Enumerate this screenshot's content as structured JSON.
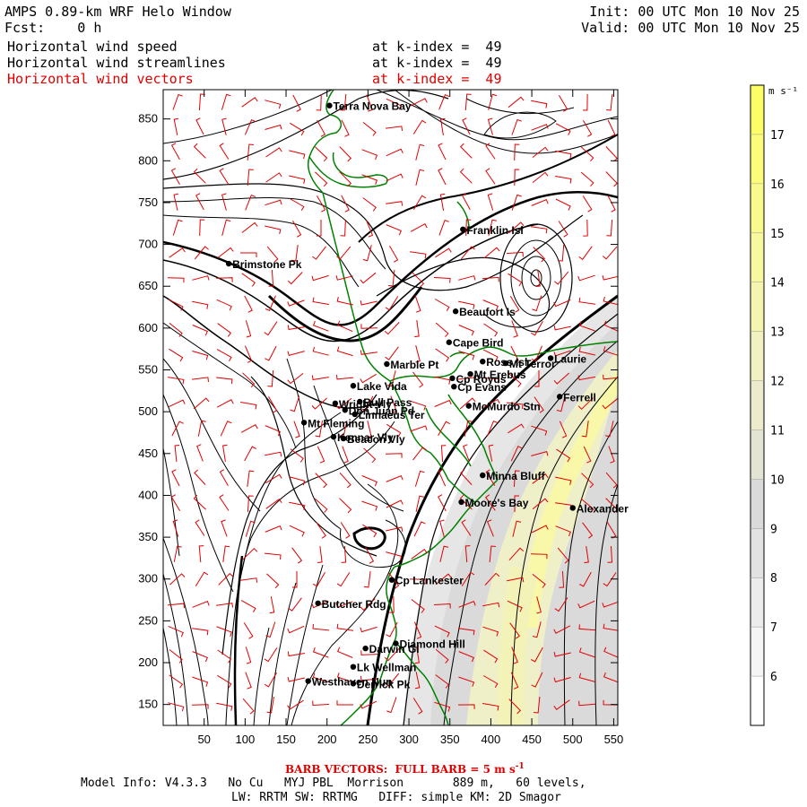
{
  "header": {
    "title": "AMPS 0.89-km WRF Helo Window",
    "fcst": "Fcst:    0 h",
    "init": "Init: 00 UTC Mon 10 Nov 25",
    "valid": "Valid: 00 UTC Mon 10 Nov 25",
    "fields": [
      {
        "name": "Horizontal wind speed",
        "level": "at k-index =  49",
        "color": "#000000"
      },
      {
        "name": "Horizontal wind streamlines",
        "level": "at k-index =  49",
        "color": "#000000"
      },
      {
        "name": "Horizontal wind vectors",
        "level": "at k-index =  49",
        "color": "#e00000"
      }
    ]
  },
  "map": {
    "x_ticks": [
      50,
      100,
      150,
      200,
      250,
      300,
      350,
      400,
      450,
      500,
      550
    ],
    "y_ticks": [
      150,
      200,
      250,
      300,
      350,
      400,
      450,
      500,
      550,
      600,
      650,
      700,
      750,
      800,
      850
    ],
    "xlim": [
      0,
      555
    ],
    "ylim": [
      125,
      885
    ],
    "coast_color": "#008000",
    "barb_color": "#e00000",
    "stations": [
      {
        "name": "Terra Nova Bay",
        "x": 203,
        "y": 866
      },
      {
        "name": "Franklin Isl",
        "x": 366,
        "y": 718
      },
      {
        "name": "Brimstone Pk",
        "x": 80,
        "y": 677
      },
      {
        "name": "Beaufort Is",
        "x": 357,
        "y": 620
      },
      {
        "name": "Cape Bird",
        "x": 349,
        "y": 583
      },
      {
        "name": "Marble Pt",
        "x": 273,
        "y": 557
      },
      {
        "name": "Lake Vida",
        "x": 232,
        "y": 531
      },
      {
        "name": "Cp Royds",
        "x": 353,
        "y": 540
      },
      {
        "name": "Cp Evans",
        "x": 355,
        "y": 530
      },
      {
        "name": "Mt Erebus",
        "x": 375,
        "y": 545
      },
      {
        "name": "Ross Isl",
        "x": 390,
        "y": 560
      },
      {
        "name": "Mt Terror",
        "x": 418,
        "y": 558
      },
      {
        "name": "Laurie",
        "x": 473,
        "y": 564
      },
      {
        "name": "Ferrell",
        "x": 484,
        "y": 518
      },
      {
        "name": "Wright Vly",
        "x": 210,
        "y": 510
      },
      {
        "name": "Don Juan Pd",
        "x": 222,
        "y": 502
      },
      {
        "name": "Bull Pass",
        "x": 240,
        "y": 512
      },
      {
        "name": "Linnaeus Ter",
        "x": 234,
        "y": 497
      },
      {
        "name": "Mt Fleming",
        "x": 172,
        "y": 487
      },
      {
        "name": "Kennar Vly",
        "x": 208,
        "y": 470
      },
      {
        "name": "Beacon Vly",
        "x": 220,
        "y": 468
      },
      {
        "name": "McMurdo Stn",
        "x": 373,
        "y": 507
      },
      {
        "name": "Minna Bluff",
        "x": 390,
        "y": 424
      },
      {
        "name": "Moore's Bay",
        "x": 364,
        "y": 392
      },
      {
        "name": "Alexander",
        "x": 500,
        "y": 385
      },
      {
        "name": "Cp Lankester",
        "x": 279,
        "y": 299
      },
      {
        "name": "Butcher Rdg",
        "x": 189,
        "y": 271
      },
      {
        "name": "Darwin Gl",
        "x": 247,
        "y": 217
      },
      {
        "name": "Diamond Hill",
        "x": 284,
        "y": 223
      },
      {
        "name": "Lk Wellman",
        "x": 232,
        "y": 195
      },
      {
        "name": "Westhaven Nun",
        "x": 177,
        "y": 178
      },
      {
        "name": "Derrick Pk",
        "x": 232,
        "y": 175
      }
    ]
  },
  "colorbar": {
    "unit": "m s⁻¹",
    "labels": [
      "6",
      "7",
      "8",
      "9",
      "10",
      "11",
      "12",
      "13",
      "14",
      "15",
      "16",
      "17"
    ],
    "colors": [
      "#ffffff",
      "#f5f5f5",
      "#ececec",
      "#e2e2e2",
      "#dadada",
      "#e4e4d4",
      "#ececcc",
      "#f1f1c1",
      "#f5f5b0",
      "#f8f89e",
      "#fafa8c",
      "#fcfc7a",
      "#fdfd66"
    ]
  },
  "footer": {
    "barb_note": "BARB VECTORS:  FULL BARB = 5 m s",
    "barb_sup": "-1",
    "model_line": "Model Info: V4.3.3   No Cu   MYJ PBL  Morrison       889 m,   60 levels,",
    "physics_line": "LW: RRTM SW: RRTMG   DIFF: simple KM: 2D Smagor"
  }
}
